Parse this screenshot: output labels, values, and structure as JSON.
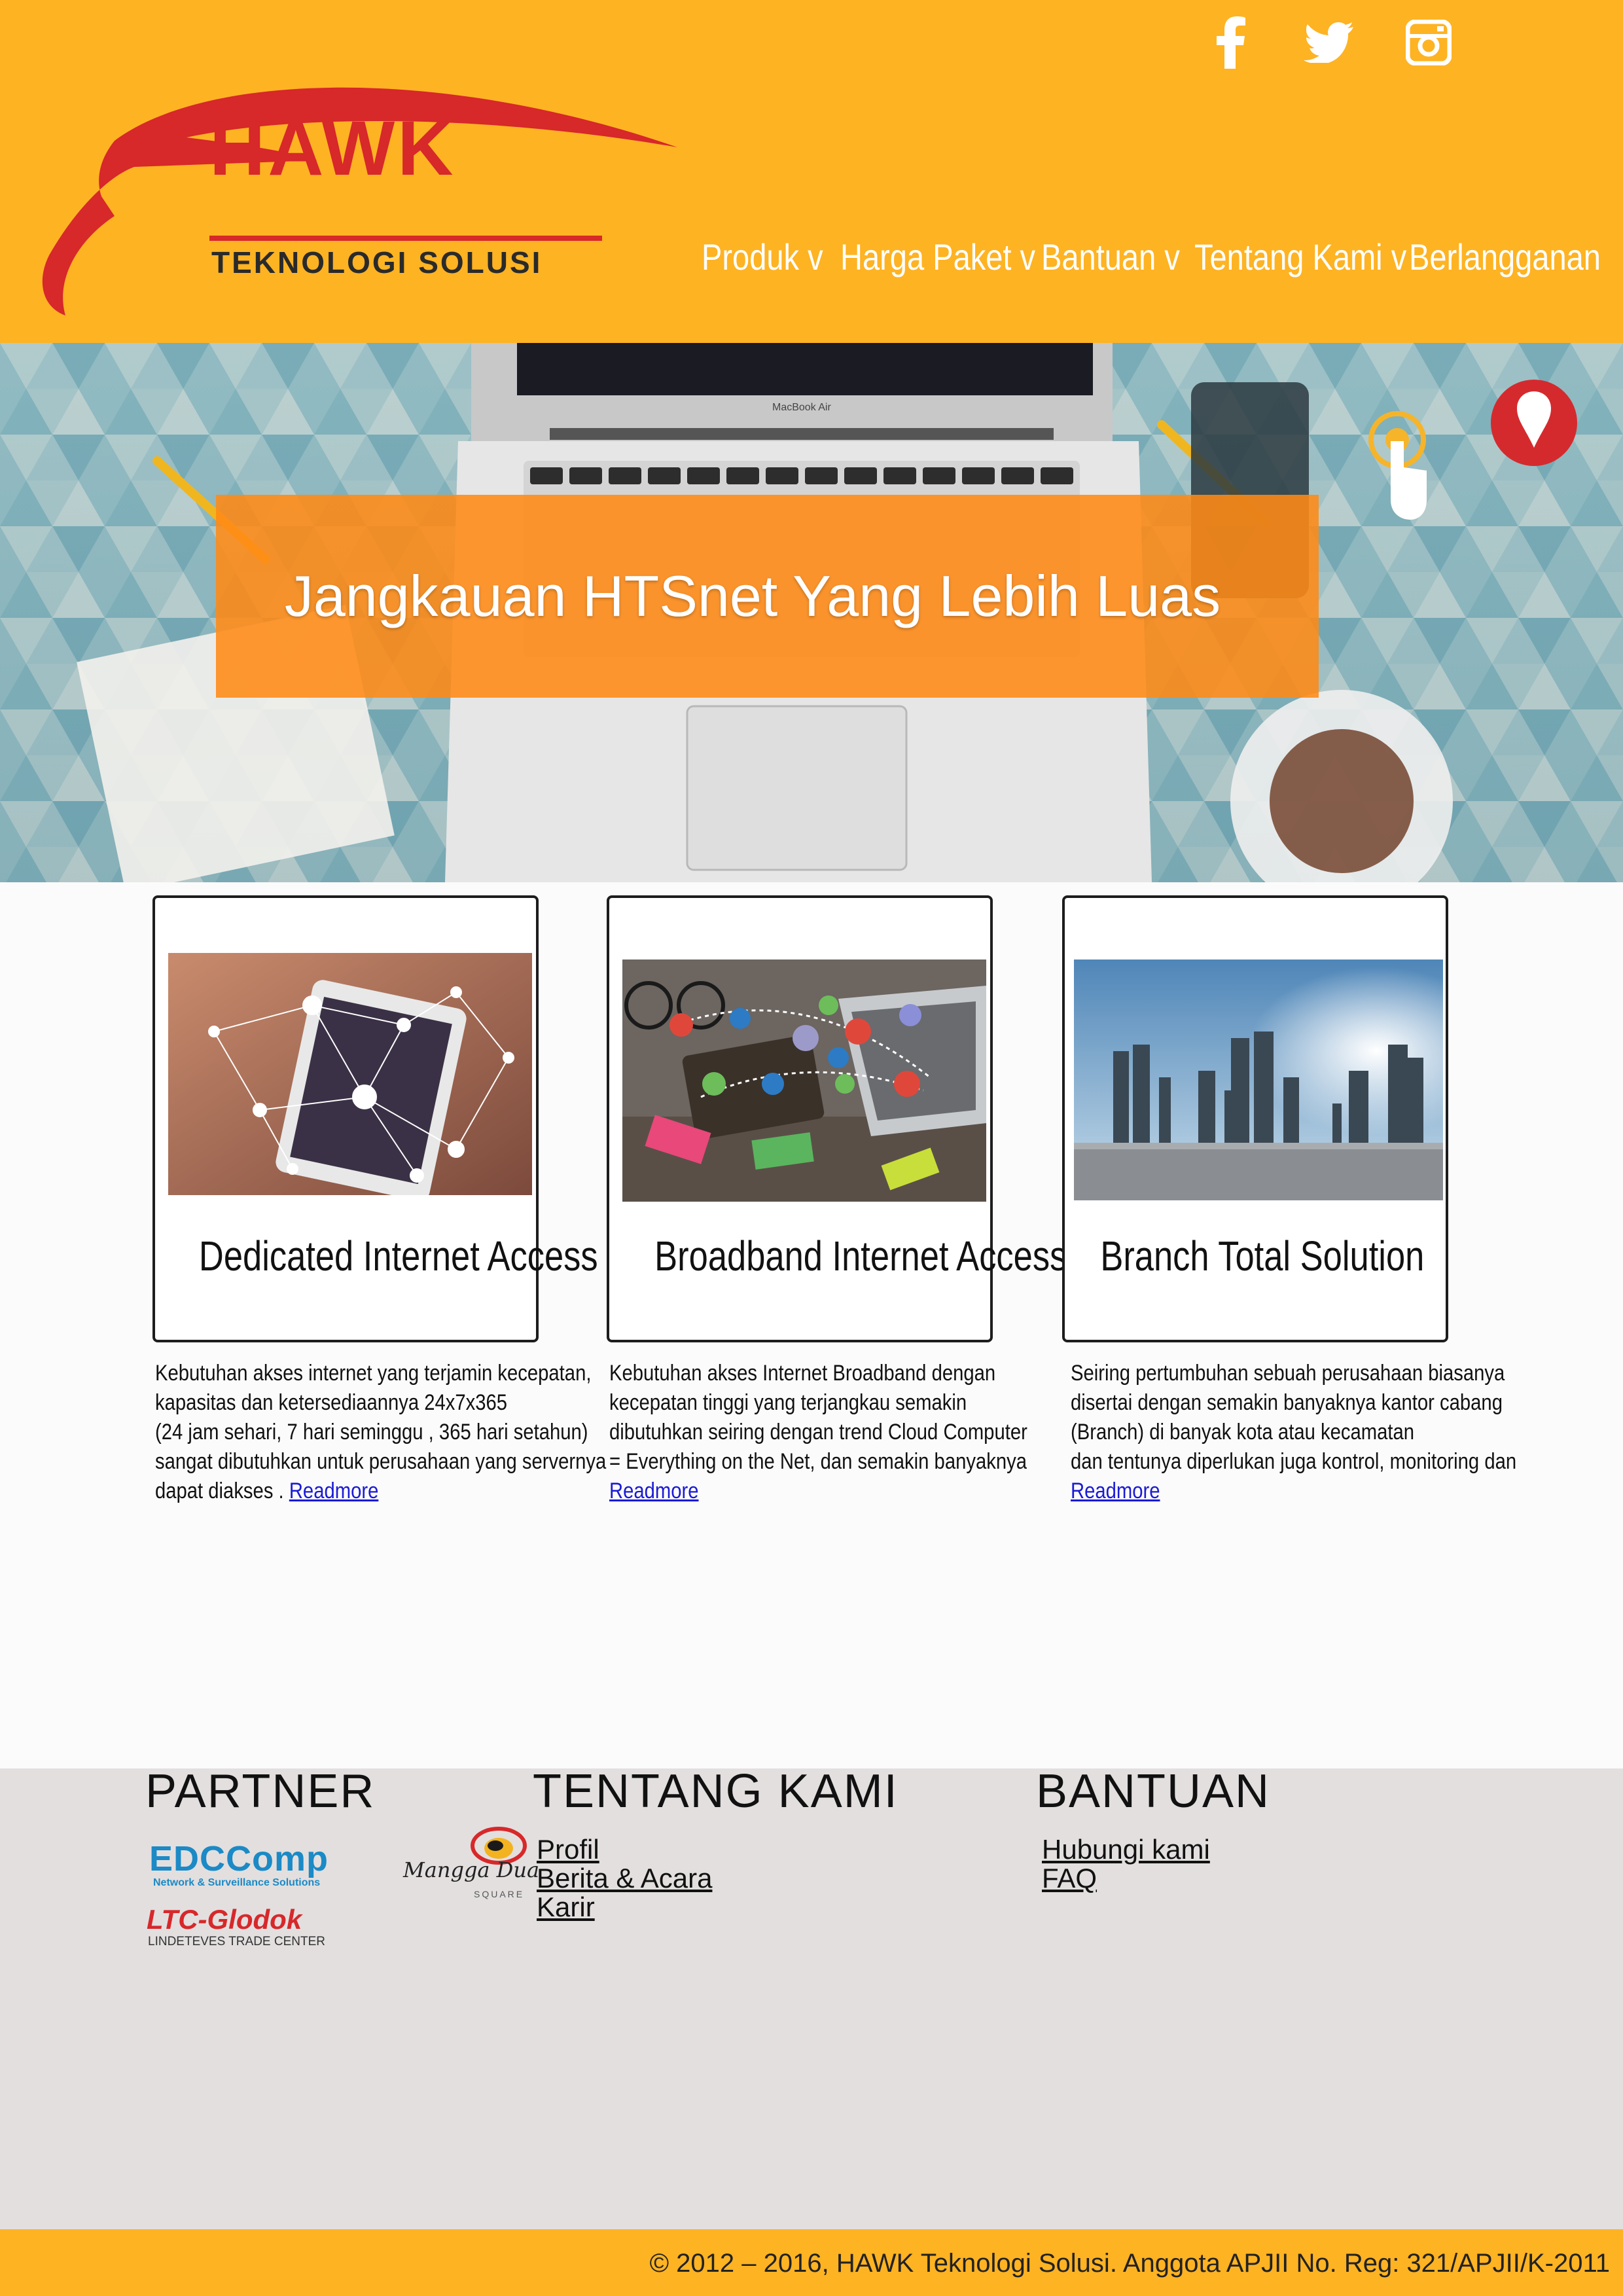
{
  "brand": {
    "name": "HAWK",
    "tagline": "TEKNOLOGI SOLUSI",
    "color_primary": "#feb323",
    "color_red": "#d7282a"
  },
  "social": [
    "facebook-icon",
    "twitter-icon",
    "instagram-icon"
  ],
  "nav": [
    {
      "label": "Produk v"
    },
    {
      "label": "Harga Paket v"
    },
    {
      "label": "Bantuan v"
    },
    {
      "label": "Tentang Kami v"
    },
    {
      "label": "Berlangganan"
    }
  ],
  "hero": {
    "title": "Jangkauan HTSnet Yang Lebih Luas",
    "laptop_brand": "MacBook Air"
  },
  "cards": [
    {
      "title": "Dedicated Internet Access",
      "lines": [
        "Kebutuhan akses internet yang terjamin kecepatan,",
        "kapasitas dan ketersediaannya 24x7x365",
        "(24 jam sehari, 7 hari seminggu , 365 hari setahun)",
        "sangat dibutuhkan untuk perusahaan yang servernya",
        "dapat diakses ."
      ],
      "readmore": "Readmore"
    },
    {
      "title": "Broadband Internet Access",
      "lines": [
        "Kebutuhan akses Internet Broadband dengan",
        "kecepatan tinggi yang terjangkau semakin",
        "dibutuhkan seiring dengan trend Cloud Computer",
        "= Everything on the Net, dan semakin banyaknya"
      ],
      "readmore": "Readmore"
    },
    {
      "title": "Branch Total Solution",
      "lines": [
        "Seiring pertumbuhan sebuah perusahaan biasanya",
        "disertai dengan semakin banyaknya kantor cabang",
        "(Branch) di banyak kota atau kecamatan",
        "dan tentunya diperlukan juga kontrol, monitoring dan"
      ],
      "readmore": "Readmore"
    }
  ],
  "footer": {
    "partner_heading": "PARTNER",
    "partners": {
      "edc_name": "EDCComp",
      "edc_sub": "Network & Surveillance Solutions",
      "mangga_name": "Mangga Dua",
      "mangga_sub": "SQUARE",
      "ltc_name": "LTC-Glodok",
      "ltc_sub": "LINDETEVES TRADE CENTER"
    },
    "tentang_heading": "TENTANG KAMI",
    "tentang_links": [
      "Profil",
      "Berita & Acara",
      "Karir"
    ],
    "bantuan_heading": "BANTUAN",
    "bantuan_links": [
      "Hubungi kami",
      "FAQ"
    ]
  },
  "copyright": "© 2012 – 2016, HAWK Teknologi Solusi. Anggota APJII No. Reg: 321/APJII/K-2011"
}
